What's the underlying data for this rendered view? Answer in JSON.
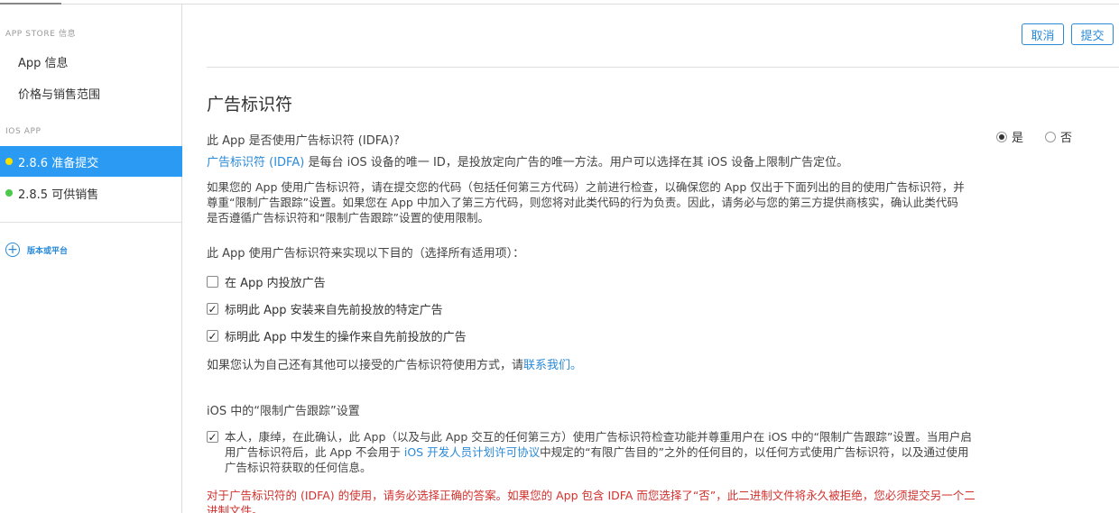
{
  "sidebar": {
    "appstore_section": "APP STORE 信息",
    "items": [
      {
        "label": "App 信息"
      },
      {
        "label": "价格与销售范围"
      }
    ],
    "ios_section": "IOS APP",
    "versions": [
      {
        "label": "2.8.6 准备提交",
        "status_color": "#f7e100",
        "active": true
      },
      {
        "label": "2.8.5 可供销售",
        "status_color": "#4cc84c",
        "active": false
      }
    ],
    "add_platform": "版本或平台"
  },
  "toolbar": {
    "cancel_label": "取消",
    "submit_label": "提交"
  },
  "idfa": {
    "title": "广告标识符",
    "question": "此 App 是否使用广告标识符 (IDFA)?",
    "radio_yes": "是",
    "radio_no": "否",
    "selected": "是",
    "desc_link": "广告标识符 (IDFA)",
    "desc_rest": " 是每台 iOS 设备的唯一 ID，是投放定向广告的唯一方法。用户可以选择在其 iOS 设备上限制广告定位。",
    "para": "如果您的 App 使用广告标识符，请在提交您的代码（包括任何第三方代码）之前进行检查，以确保您的 App 仅出于下面列出的目的使用广告标识符，并尊重“限制广告跟踪”设置。如果您在 App 中加入了第三方代码，则您将对此类代码的行为负责。因此，请务必与您的第三方提供商核实，确认此类代码是否遵循广告标识符和“限制广告跟踪”设置的使用限制。",
    "purpose_prompt": "此 App 使用广告标识符来实现以下目的（选择所有适用项）：",
    "options": [
      {
        "label": "在 App 内投放广告",
        "checked": false
      },
      {
        "label": "标明此 App 安装来自先前投放的特定广告",
        "checked": true
      },
      {
        "label": "标明此 App 中发生的操作来自先前投放的广告",
        "checked": true
      }
    ],
    "other_prefix": "如果您认为自己还有其他可以接受的广告标识符使用方式，请",
    "other_link": "联系我们",
    "other_suffix": "。",
    "limit_heading": "iOS 中的“限制广告跟踪”设置",
    "consent_part1": "本人，康绰，在此确认，此 App（以及与此 App 交互的任何第三方）使用广告标识符检查功能并尊重用户在 iOS 中的“限制广告跟踪”设置。当用户启用广告标识符后，此 App 不会用于 ",
    "consent_link": "iOS 开发人员计划许可协议",
    "consent_part2": "中规定的“有限广告目的”之外的任何目的，以任何方式使用广告标识符，以及通过使用广告标识符获取的任何信息。",
    "consent_checked": true,
    "warning": "对于广告标识符的 (IDFA) 的使用，请务必选择正确的答案。如果您的 App 包含 IDFA 而您选择了“否”，此二进制文件将永久被拒绝，您必须提交另一个二进制文件。"
  }
}
